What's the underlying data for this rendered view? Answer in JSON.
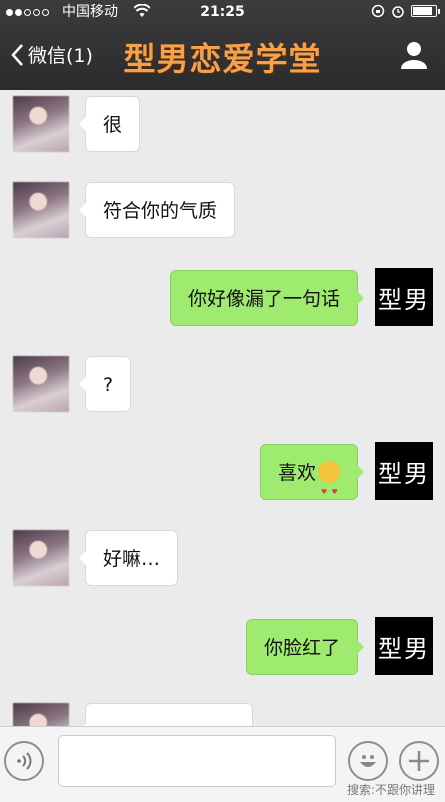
{
  "status_bar": {
    "carrier": "中国移动",
    "time": "21:25"
  },
  "nav": {
    "back_label": "微信(1)",
    "title": "型男恋爱学堂"
  },
  "messages": [
    {
      "side": "left",
      "text": "很"
    },
    {
      "side": "left",
      "text": "符合你的气质"
    },
    {
      "side": "right",
      "text": "你好像漏了一句话",
      "avatar": "型男"
    },
    {
      "side": "left",
      "text": "?"
    },
    {
      "side": "right",
      "text": "喜欢",
      "avatar": "型男",
      "emoji": "heart-eyes-emoji"
    },
    {
      "side": "left",
      "text": "好嘛…"
    },
    {
      "side": "right",
      "text": "你脸红了",
      "avatar": "型男"
    }
  ],
  "input": {
    "value": "",
    "placeholder": ""
  },
  "watermark": "搜索:不跟你讲理"
}
